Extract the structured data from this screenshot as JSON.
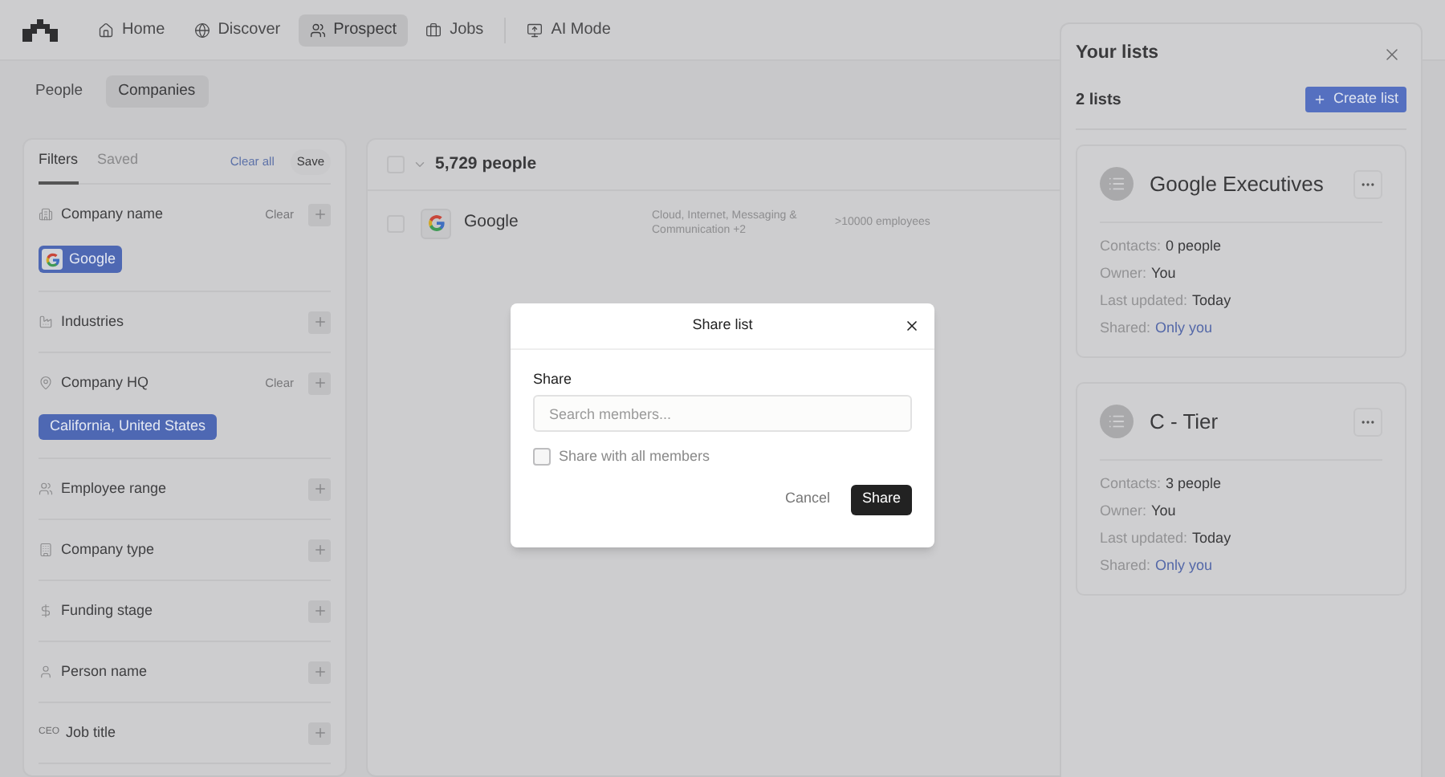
{
  "nav": {
    "items": [
      {
        "label": "Home",
        "selected": false
      },
      {
        "label": "Discover",
        "selected": false
      },
      {
        "label": "Prospect",
        "selected": true
      },
      {
        "label": "Jobs",
        "selected": false
      },
      {
        "label": "AI Mode",
        "selected": false
      }
    ]
  },
  "subtabs": [
    {
      "label": "People",
      "selected": false
    },
    {
      "label": "Companies",
      "selected": true
    }
  ],
  "filters": {
    "tabs": [
      {
        "label": "Filters",
        "selected": true
      },
      {
        "label": "Saved",
        "selected": false
      }
    ],
    "clear_all": "Clear all",
    "save": "Save",
    "groups": [
      {
        "label": "Company name",
        "clear": "Clear",
        "chips": [
          {
            "label": "Google",
            "kind": "company"
          }
        ]
      },
      {
        "label": "Industries"
      },
      {
        "label": "Company HQ",
        "clear": "Clear",
        "chips": [
          {
            "label": "California, United States",
            "kind": "location"
          }
        ]
      },
      {
        "label": "Employee range"
      },
      {
        "label": "Company type"
      },
      {
        "label": "Funding stage"
      },
      {
        "label": "Person name"
      },
      {
        "label": "Job title",
        "icon_text": "CEO"
      }
    ]
  },
  "results": {
    "all_selected": false,
    "count": "5,729 people",
    "rows": [
      {
        "name": "Google",
        "industries": "Cloud, Internet, Messaging & Communication +2",
        "size": ">10000 employees",
        "selected": false
      }
    ]
  },
  "lists_panel": {
    "title": "Your lists",
    "count": "2 lists",
    "create_button": "Create list",
    "lists": [
      {
        "name": "Google Executives",
        "fields": [
          {
            "label": "Contacts:",
            "value": "0 people",
            "kind": "text"
          },
          {
            "label": "Owner:",
            "value": "You",
            "kind": "text"
          },
          {
            "label": "Last updated:",
            "value": "Today",
            "kind": "text"
          },
          {
            "label": "Shared:",
            "value": "Only you",
            "kind": "link"
          }
        ]
      },
      {
        "name": "C - Tier",
        "fields": [
          {
            "label": "Contacts:",
            "value": "3 people",
            "kind": "text"
          },
          {
            "label": "Owner:",
            "value": "You",
            "kind": "text"
          },
          {
            "label": "Last updated:",
            "value": "Today",
            "kind": "text"
          },
          {
            "label": "Shared:",
            "value": "Only you",
            "kind": "link"
          }
        ]
      }
    ]
  },
  "modal": {
    "title": "Share list",
    "section_label": "Share",
    "search": {
      "placeholder": "Search members..."
    },
    "checkbox": {
      "label": "Share with all members",
      "checked": false
    },
    "cancel": "Cancel",
    "submit": "Share"
  }
}
